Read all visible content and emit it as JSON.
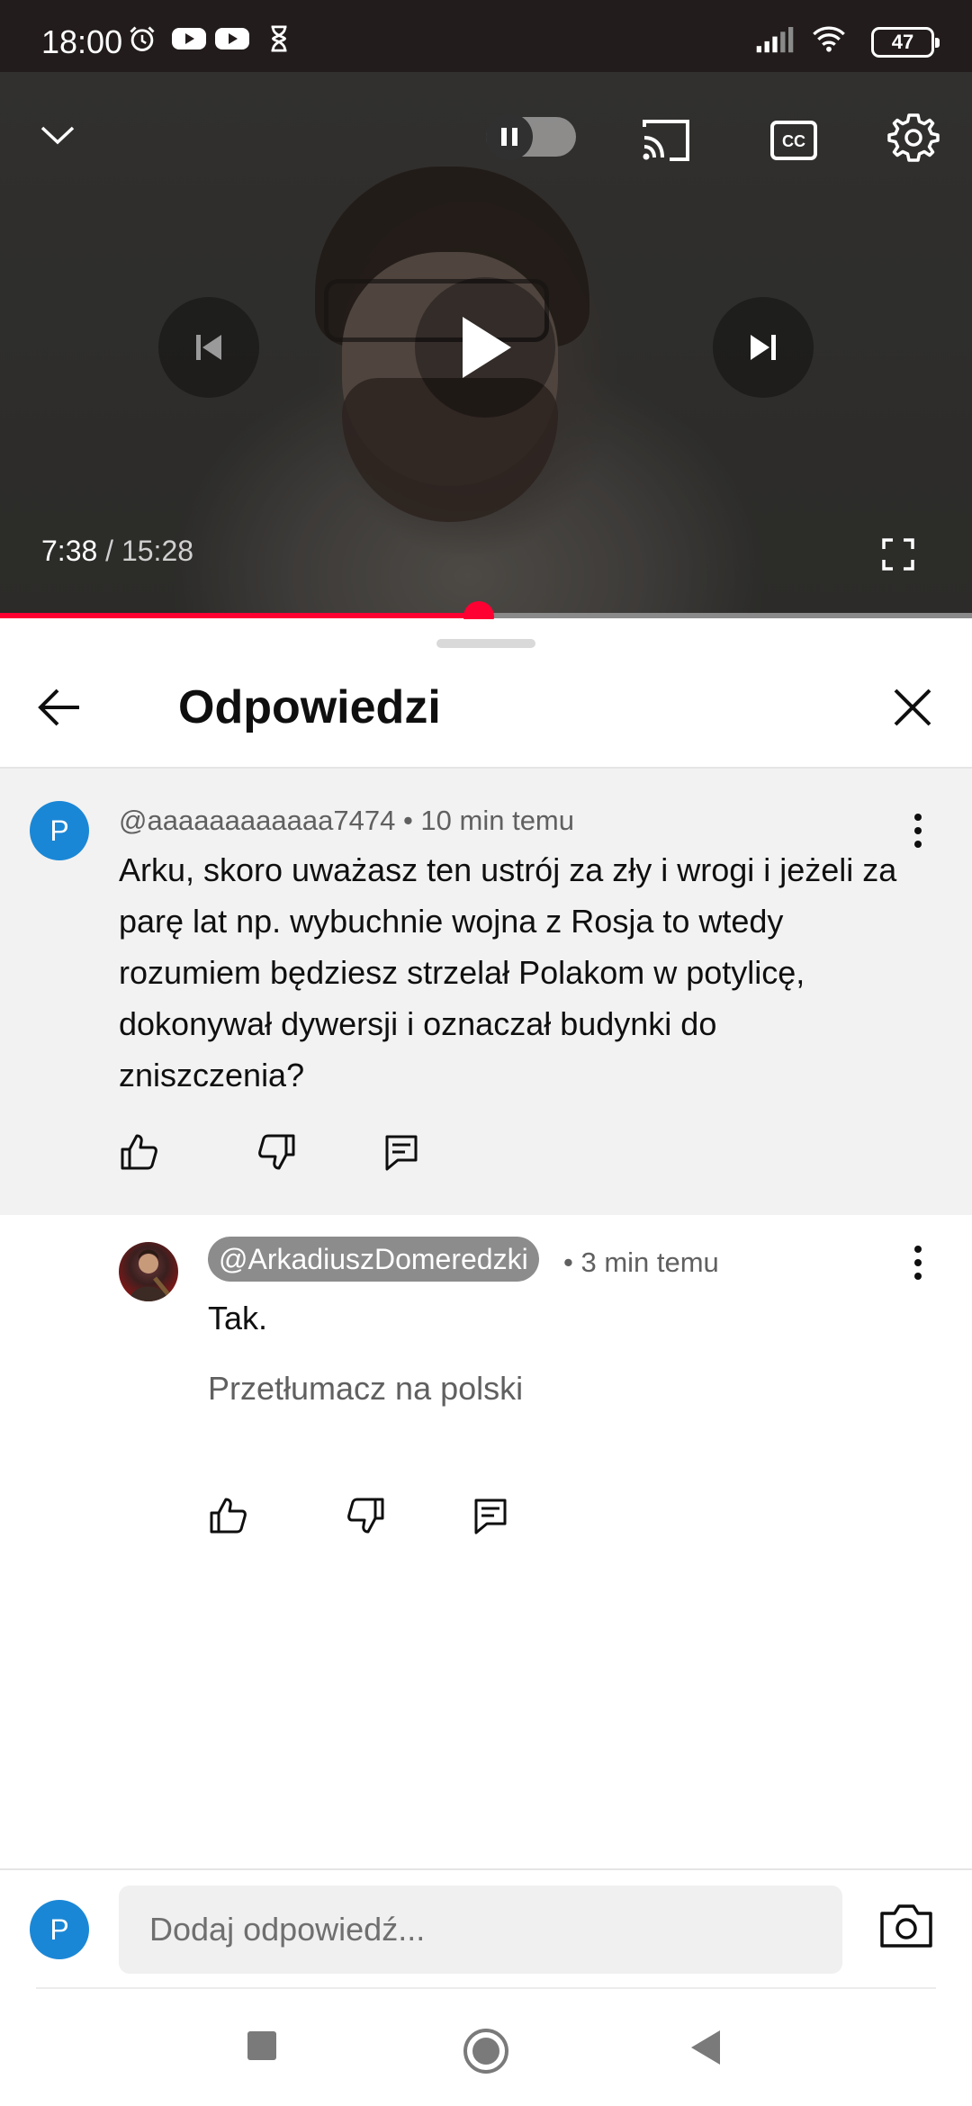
{
  "status_bar": {
    "time": "18:00",
    "battery": "47",
    "icons": [
      "alarm-icon",
      "youtube-icon",
      "youtube-icon",
      "hourglass-icon",
      "signal-icon",
      "wifi-icon",
      "battery-icon"
    ]
  },
  "player": {
    "current_time": "7:38",
    "separator": " / ",
    "duration": "15:28",
    "progress": 0.493,
    "accent_color": "#ff0033"
  },
  "panel": {
    "title": "Odpowiedzi"
  },
  "parent_comment": {
    "avatar_letter": "P",
    "author": "@aaaaaaaaaaaa7474",
    "time": "10 min temu",
    "text": "Arku, skoro uważasz ten ustrój za zły i wrogi i jeżeli za parę lat np. wybuchnie wojna z Rosja to wtedy rozumiem będziesz strzelał Polakom w potylicę, dokonywał dywersji i oznaczał budynki do zniszczenia?"
  },
  "reply": {
    "author": "@ArkadiuszDomeredzki",
    "time": "• 3 min temu",
    "text": "Tak.",
    "translate_label": "Przetłumacz na polski"
  },
  "input": {
    "avatar_letter": "P",
    "placeholder": "Dodaj odpowiedź..."
  },
  "colors": {
    "avatar_blue": "#1a87d6",
    "chip_gray": "#8c8c8c"
  }
}
